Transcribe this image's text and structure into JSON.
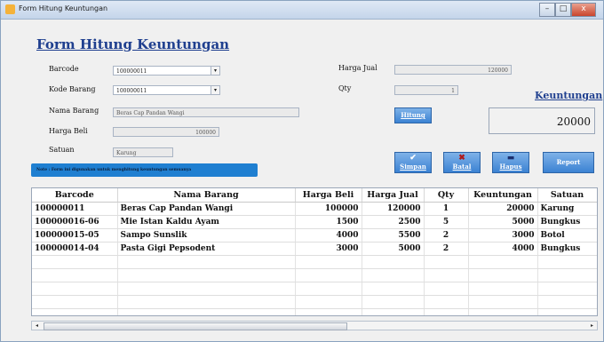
{
  "window": {
    "title": "Form Hitung Keuntungan",
    "btn_min": "–",
    "btn_max": "□",
    "btn_close": "x"
  },
  "form_title": "Form Hitung Keuntungan",
  "labels": {
    "barcode": "Barcode",
    "kode_barang": "Kode Barang",
    "nama_barang": "Nama Barang",
    "harga_beli": "Harga Beli",
    "satuan": "Satuan",
    "harga_jual": "Harga Jual",
    "qty": "Qty",
    "keuntungan": "Keuntungan"
  },
  "fields": {
    "barcode": "100000011",
    "kode_barang": "100000011",
    "nama_barang": "Beras Cap Pandan Wangi",
    "harga_beli": "100000",
    "satuan": "Karung",
    "harga_jual": "120000",
    "qty": "1"
  },
  "keuntungan_value": "20000",
  "buttons": {
    "hitung": "Hitung",
    "simpan": "Simpan",
    "batal": "Batal",
    "hapus": "Hapus",
    "report": "Report"
  },
  "note": "Note : Form ini digunakan untuk menghitung keuntungan semuanya",
  "table": {
    "columns": [
      "Barcode",
      "Nama Barang",
      "Harga Beli",
      "Harga Jual",
      "Qty",
      "Keuntungan",
      "Satuan"
    ],
    "rows": [
      [
        "100000011",
        "Beras Cap Pandan Wangi",
        "100000",
        "120000",
        "1",
        "20000",
        "Karung"
      ],
      [
        "100000016-06",
        "Mie Istan Kaldu Ayam",
        "1500",
        "2500",
        "5",
        "5000",
        "Bungkus"
      ],
      [
        "100000015-05",
        "Sampo Sunslik",
        "4000",
        "5500",
        "2",
        "3000",
        "Botol"
      ],
      [
        "100000014-04",
        "Pasta Gigi Pepsodent",
        "3000",
        "5000",
        "2",
        "4000",
        "Bungkus"
      ]
    ]
  },
  "icons": {
    "app": "app-icon",
    "simpan": "check-icon",
    "batal": "x-icon",
    "hapus": "trash-icon"
  },
  "colors": {
    "accent": "#1f3f8f",
    "button": "#3b82d3",
    "note_bg": "#1f7fd1"
  }
}
